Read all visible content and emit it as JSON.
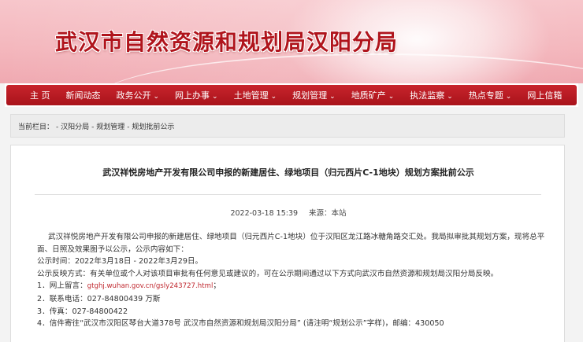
{
  "site": {
    "title": "武汉市自然资源和规划局汉阳分局"
  },
  "nav": {
    "items": [
      {
        "label": "主 页",
        "has_dropdown": false
      },
      {
        "label": "新闻动态",
        "has_dropdown": false
      },
      {
        "label": "政务公开",
        "has_dropdown": true
      },
      {
        "label": "网上办事",
        "has_dropdown": true
      },
      {
        "label": "土地管理",
        "has_dropdown": true
      },
      {
        "label": "规划管理",
        "has_dropdown": true
      },
      {
        "label": "地质矿产",
        "has_dropdown": true
      },
      {
        "label": "执法监察",
        "has_dropdown": true
      },
      {
        "label": "热点专题",
        "has_dropdown": true
      },
      {
        "label": "网上信箱",
        "has_dropdown": false
      }
    ],
    "caret": "⌄"
  },
  "breadcrumb": {
    "prefix": "当前栏目：",
    "items": [
      "- 汉阳分局",
      "- 规划管理",
      "- 规划批前公示"
    ]
  },
  "article": {
    "title": "武汉祥悦房地产开发有限公司申报的新建居住、绿地项目（归元西片C-1地块）规划方案批前公示",
    "date": "2022-03-18 15:39",
    "source": "来源：本站",
    "paragraph1": "武汉祥悦房地产开发有限公司申报的新建居住、绿地项目（归元西片C-1地块）位于汉阳区龙江路冰糖角路交汇处。我局拟审批其规划方案，现将总平面、日照及效果图予以公示，公示内容如下：",
    "period": "公示时间：2022年3月18日 - 2022年3月29日。",
    "feedback": "公示反映方式：有关单位或个人对该项目审批有任何意见或建议的，可在公示期间通过以下方式向武汉市自然资源和规划局汉阳分局反映。",
    "item1_label": "1．网上留言：",
    "item1_link": "gtghj.wuhan.gov.cn/gsly243727.html",
    "item1_suffix": "；",
    "item2": "2．联系电话：027-84800439 万斯",
    "item3": "3．传真：027-84800422",
    "item4": "4．信件寄往“武汉市汉阳区琴台大道378号  武汉市自然资源和规划局汉阳分局” (请注明“规划公示”字样)，邮编：430050"
  },
  "colors": {
    "nav_red": "#b0141c",
    "title_red": "#b0141c",
    "link_red": "#c0282f"
  }
}
